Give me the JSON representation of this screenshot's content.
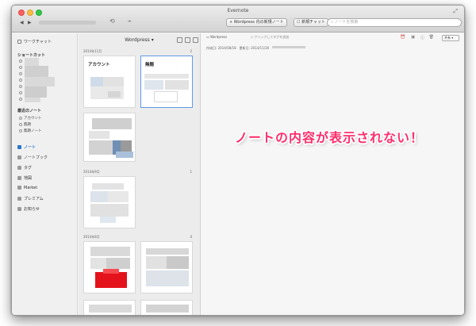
{
  "window": {
    "title": "Evernote"
  },
  "toolbar": {
    "new_note_label": "+ Wordpress 内の新規ノート",
    "new_chat_label": "新規チャット",
    "search_placeholder": "ノートを検索"
  },
  "sidebar": {
    "work_chat": "ワークチャット",
    "shortcuts_heading": "ショートカット",
    "recent_heading": "最近のノート",
    "recent_items": [
      "アカウント",
      "無題",
      "無題ノート"
    ],
    "nav": [
      "ノート",
      "ノートブック",
      "タグ",
      "地図",
      "Market",
      "プレミアム",
      "お知らせ"
    ]
  },
  "notelist": {
    "notebook_title": "Wordpress ▾",
    "months": [
      {
        "label": "2014年11月",
        "count": "2"
      },
      {
        "label": "2014年9月",
        "count": "1"
      },
      {
        "label": "2014年8月",
        "count": "4"
      }
    ],
    "cards": [
      {
        "title": "アカウント"
      },
      {
        "title": "無題"
      }
    ]
  },
  "editor": {
    "notebook": "Wordpress",
    "add_tag": "クリックしてタグを追加",
    "created": "作成日: 2014/08/18",
    "updated": "更新日: 2014/11/26",
    "share_label": "共有 ▾"
  },
  "annotation": {
    "text": "ノートの内容が表示されない！"
  }
}
